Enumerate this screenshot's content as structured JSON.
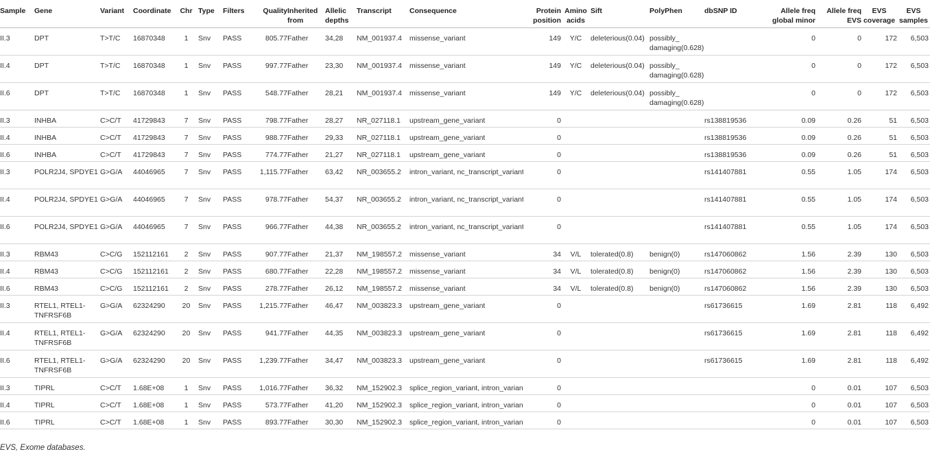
{
  "columns": [
    "Sample",
    "Gene",
    "Variant",
    "Coordinate",
    "Chr",
    "Type",
    "Filters",
    "Quality",
    "Inherited from",
    "Allelic depths",
    "Transcript",
    "Consequence",
    "Protein position",
    "Amino acids",
    "Sift",
    "PolyPhen",
    "dbSNP ID",
    "Allele freq global minor",
    "Allele freq EVS",
    "EVS coverage",
    "EVS samples"
  ],
  "rows": [
    [
      "II.3",
      "DPT",
      "T>T/C",
      "16870348",
      "1",
      "Snv",
      "PASS",
      "805.77",
      "Father",
      "34,28",
      "NM_001937.4",
      "missense_variant",
      "149",
      "Y/C",
      "deleterious(0.04)",
      "possibly_ damaging(0.628)",
      "",
      "0",
      "0",
      "172",
      "6,503"
    ],
    [
      "II.4",
      "DPT",
      "T>T/C",
      "16870348",
      "1",
      "Snv",
      "PASS",
      "997.77",
      "Father",
      "23,30",
      "NM_001937.4",
      "missense_variant",
      "149",
      "Y/C",
      "deleterious(0.04)",
      "possibly_ damaging(0.628)",
      "",
      "0",
      "0",
      "172",
      "6,503"
    ],
    [
      "II.6",
      "DPT",
      "T>T/C",
      "16870348",
      "1",
      "Snv",
      "PASS",
      "548.77",
      "Father",
      "28,21",
      "NM_001937.4",
      "missense_variant",
      "149",
      "Y/C",
      "deleterious(0.04)",
      "possibly_ damaging(0.628)",
      "",
      "0",
      "0",
      "172",
      "6,503"
    ],
    [
      "II.3",
      "INHBA",
      "C>C/T",
      "41729843",
      "7",
      "Snv",
      "PASS",
      "798.77",
      "Father",
      "28,27",
      "NR_027118.1",
      "upstream_gene_variant",
      "0",
      "",
      "",
      "",
      "rs138819536",
      "0.09",
      "0.26",
      "51",
      "6,503"
    ],
    [
      "II.4",
      "INHBA",
      "C>C/T",
      "41729843",
      "7",
      "Snv",
      "PASS",
      "988.77",
      "Father",
      "29,33",
      "NR_027118.1",
      "upstream_gene_variant",
      "0",
      "",
      "",
      "",
      "rs138819536",
      "0.09",
      "0.26",
      "51",
      "6,503"
    ],
    [
      "II.6",
      "INHBA",
      "C>C/T",
      "41729843",
      "7",
      "Snv",
      "PASS",
      "774.77",
      "Father",
      "21,27",
      "NR_027118.1",
      "upstream_gene_variant",
      "0",
      "",
      "",
      "",
      "rs138819536",
      "0.09",
      "0.26",
      "51",
      "6,503"
    ],
    [
      "II.3",
      "POLR2J4, SPDYE1",
      "G>G/A",
      "44046965",
      "7",
      "Snv",
      "PASS",
      "1,115.77",
      "Father",
      "63,42",
      "NR_003655.2",
      "intron_variant, nc_transcript_variant",
      "0",
      "",
      "",
      "",
      "rs141407881",
      "0.55",
      "1.05",
      "174",
      "6,503"
    ],
    [
      "II.4",
      "POLR2J4, SPDYE1",
      "G>G/A",
      "44046965",
      "7",
      "Snv",
      "PASS",
      "978.77",
      "Father",
      "54,37",
      "NR_003655.2",
      "intron_variant, nc_transcript_variant",
      "0",
      "",
      "",
      "",
      "rs141407881",
      "0.55",
      "1.05",
      "174",
      "6,503"
    ],
    [
      "II.6",
      "POLR2J4, SPDYE1",
      "G>G/A",
      "44046965",
      "7",
      "Snv",
      "PASS",
      "966.77",
      "Father",
      "44,38",
      "NR_003655.2",
      "intron_variant, nc_transcript_variant",
      "0",
      "",
      "",
      "",
      "rs141407881",
      "0.55",
      "1.05",
      "174",
      "6,503"
    ],
    [
      "II.3",
      "RBM43",
      "C>C/G",
      "152112161",
      "2",
      "Snv",
      "PASS",
      "907.77",
      "Father",
      "21,37",
      "NM_198557.2",
      "missense_variant",
      "34",
      "V/L",
      "tolerated(0.8)",
      "benign(0)",
      "rs147060862",
      "1.56",
      "2.39",
      "130",
      "6,503"
    ],
    [
      "II.4",
      "RBM43",
      "C>C/G",
      "152112161",
      "2",
      "Snv",
      "PASS",
      "680.77",
      "Father",
      "22,28",
      "NM_198557.2",
      "missense_variant",
      "34",
      "V/L",
      "tolerated(0.8)",
      "benign(0)",
      "rs147060862",
      "1.56",
      "2.39",
      "130",
      "6,503"
    ],
    [
      "II.6",
      "RBM43",
      "C>C/G",
      "152112161",
      "2",
      "Snv",
      "PASS",
      "278.77",
      "Father",
      "26,12",
      "NM_198557.2",
      "missense_variant",
      "34",
      "V/L",
      "tolerated(0.8)",
      "benign(0)",
      "rs147060862",
      "1.56",
      "2.39",
      "130",
      "6,503"
    ],
    [
      "II.3",
      "RTEL1, RTEL1-TNFRSF6B",
      "G>G/A",
      "62324290",
      "20",
      "Snv",
      "PASS",
      "1,215.77",
      "Father",
      "46,47",
      "NM_003823.3",
      "upstream_gene_variant",
      "0",
      "",
      "",
      "",
      "rs61736615",
      "1.69",
      "2.81",
      "118",
      "6,492"
    ],
    [
      "II.4",
      "RTEL1, RTEL1-TNFRSF6B",
      "G>G/A",
      "62324290",
      "20",
      "Snv",
      "PASS",
      "941.77",
      "Father",
      "44,35",
      "NM_003823.3",
      "upstream_gene_variant",
      "0",
      "",
      "",
      "",
      "rs61736615",
      "1.69",
      "2.81",
      "118",
      "6,492"
    ],
    [
      "II.6",
      "RTEL1, RTEL1-TNFRSF6B",
      "G>G/A",
      "62324290",
      "20",
      "Snv",
      "PASS",
      "1,239.77",
      "Father",
      "34,47",
      "NM_003823.3",
      "upstream_gene_variant",
      "0",
      "",
      "",
      "",
      "rs61736615",
      "1.69",
      "2.81",
      "118",
      "6,492"
    ],
    [
      "II.3",
      "TIPRL",
      "C>C/T",
      "1.68E+08",
      "1",
      "Snv",
      "PASS",
      "1,016.77",
      "Father",
      "36,32",
      "NM_152902.3",
      "splice_region_variant, intron_variant",
      "0",
      "",
      "",
      "",
      "",
      "0",
      "0.01",
      "107",
      "6,503"
    ],
    [
      "II.4",
      "TIPRL",
      "C>C/T",
      "1.68E+08",
      "1",
      "Snv",
      "PASS",
      "573.77",
      "Father",
      "41,20",
      "NM_152902.3",
      "splice_region_variant, intron_variant",
      "0",
      "",
      "",
      "",
      "",
      "0",
      "0.01",
      "107",
      "6,503"
    ],
    [
      "II.6",
      "TIPRL",
      "C>C/T",
      "1.68E+08",
      "1",
      "Snv",
      "PASS",
      "893.77",
      "Father",
      "30,30",
      "NM_152902.3",
      "splice_region_variant, intron_variant",
      "0",
      "",
      "",
      "",
      "",
      "0",
      "0.01",
      "107",
      "6,503"
    ]
  ],
  "footnote": "EVS, Exome databases."
}
